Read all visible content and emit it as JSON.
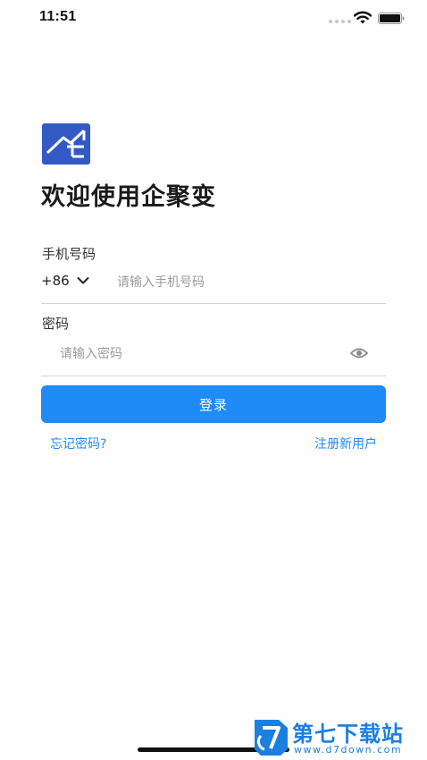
{
  "status_bar": {
    "time": "11:51"
  },
  "app": {
    "welcome_title": "欢迎使用企聚变"
  },
  "phone": {
    "label": "手机号码",
    "country_code": "+86",
    "placeholder": "请输入手机号码",
    "value": ""
  },
  "password": {
    "label": "密码",
    "placeholder": "请输入密码",
    "value": ""
  },
  "actions": {
    "login_label": "登录",
    "forgot_label": "忘记密码?",
    "register_label": "注册新用户"
  },
  "watermark": {
    "title": "第七下载站",
    "url": "www.d7down.com"
  },
  "colors": {
    "accent": "#1e8bf7",
    "logo": "#3259c4",
    "watermark": "#1b7fe0"
  },
  "icons": {
    "wifi": "wifi-icon",
    "battery": "battery-icon",
    "chevron": "chevron-down-icon",
    "eye": "eye-icon",
    "logo": "logo-house-icon"
  }
}
